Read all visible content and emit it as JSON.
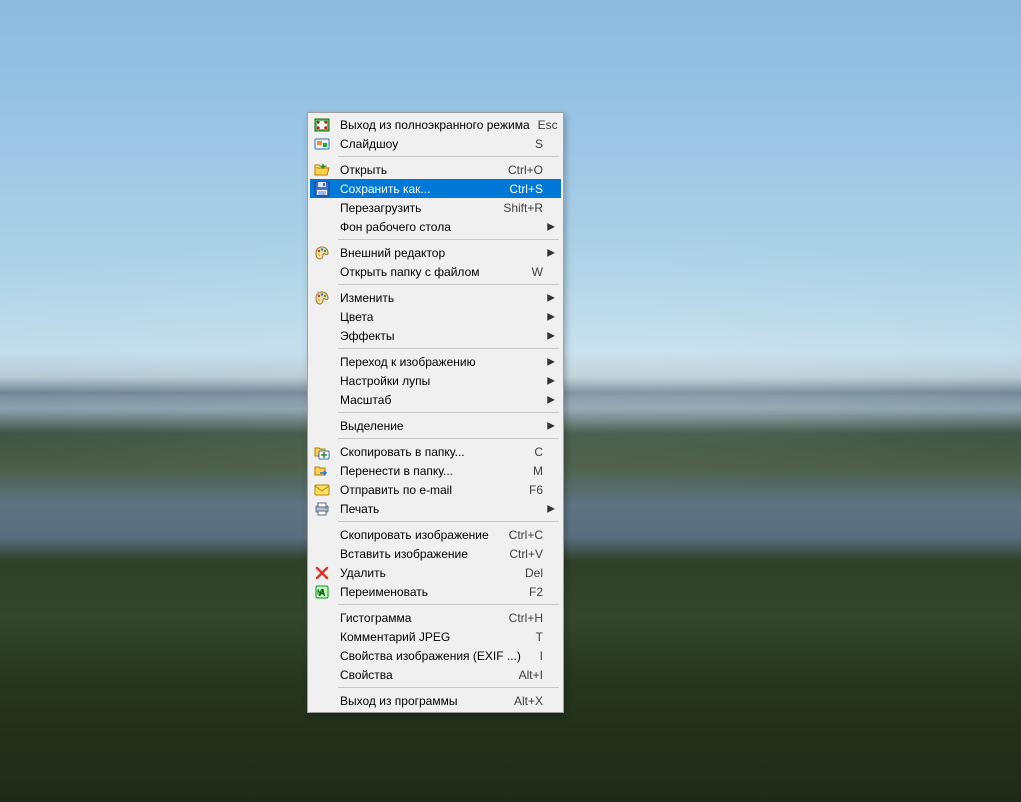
{
  "menu": {
    "groups": [
      [
        {
          "icon": "exit-fullscreen-icon",
          "label": "Выход из полноэкранного режима",
          "shortcut": "Esc",
          "submenu": false,
          "highlighted": false,
          "name": "menu-exit-fullscreen"
        },
        {
          "icon": "slideshow-icon",
          "label": "Слайдшоу",
          "shortcut": "S",
          "submenu": false,
          "highlighted": false,
          "name": "menu-slideshow"
        }
      ],
      [
        {
          "icon": "open-icon",
          "label": "Открыть",
          "shortcut": "Ctrl+O",
          "submenu": false,
          "highlighted": false,
          "name": "menu-open"
        },
        {
          "icon": "save-icon",
          "label": "Сохранить как...",
          "shortcut": "Ctrl+S",
          "submenu": false,
          "highlighted": true,
          "name": "menu-save-as"
        },
        {
          "icon": null,
          "label": "Перезагрузить",
          "shortcut": "Shift+R",
          "submenu": false,
          "highlighted": false,
          "name": "menu-reload"
        },
        {
          "icon": null,
          "label": "Фон рабочего стола",
          "shortcut": "",
          "submenu": true,
          "highlighted": false,
          "name": "menu-desktop-background"
        }
      ],
      [
        {
          "icon": "palette-icon",
          "label": "Внешний редактор",
          "shortcut": "",
          "submenu": true,
          "highlighted": false,
          "name": "menu-external-editor"
        },
        {
          "icon": null,
          "label": "Открыть папку с файлом",
          "shortcut": "W",
          "submenu": false,
          "highlighted": false,
          "name": "menu-open-folder"
        }
      ],
      [
        {
          "icon": "palette-icon",
          "label": "Изменить",
          "shortcut": "",
          "submenu": true,
          "highlighted": false,
          "name": "menu-edit"
        },
        {
          "icon": null,
          "label": "Цвета",
          "shortcut": "",
          "submenu": true,
          "highlighted": false,
          "name": "menu-colors"
        },
        {
          "icon": null,
          "label": "Эффекты",
          "shortcut": "",
          "submenu": true,
          "highlighted": false,
          "name": "menu-effects"
        }
      ],
      [
        {
          "icon": null,
          "label": "Переход к изображению",
          "shortcut": "",
          "submenu": true,
          "highlighted": false,
          "name": "menu-navigate-image"
        },
        {
          "icon": null,
          "label": "Настройки лупы",
          "shortcut": "",
          "submenu": true,
          "highlighted": false,
          "name": "menu-magnifier-settings"
        },
        {
          "icon": null,
          "label": "Масштаб",
          "shortcut": "",
          "submenu": true,
          "highlighted": false,
          "name": "menu-zoom"
        }
      ],
      [
        {
          "icon": null,
          "label": "Выделение",
          "shortcut": "",
          "submenu": true,
          "highlighted": false,
          "name": "menu-selection"
        }
      ],
      [
        {
          "icon": "copy-folder-icon",
          "label": "Скопировать в папку...",
          "shortcut": "C",
          "submenu": false,
          "highlighted": false,
          "name": "menu-copy-to-folder"
        },
        {
          "icon": "move-folder-icon",
          "label": "Перенести в папку...",
          "shortcut": "M",
          "submenu": false,
          "highlighted": false,
          "name": "menu-move-to-folder"
        },
        {
          "icon": "mail-icon",
          "label": "Отправить по e-mail",
          "shortcut": "F6",
          "submenu": false,
          "highlighted": false,
          "name": "menu-send-email"
        },
        {
          "icon": "print-icon",
          "label": "Печать",
          "shortcut": "",
          "submenu": true,
          "highlighted": false,
          "name": "menu-print"
        }
      ],
      [
        {
          "icon": null,
          "label": "Скопировать изображение",
          "shortcut": "Ctrl+C",
          "submenu": false,
          "highlighted": false,
          "name": "menu-copy-image"
        },
        {
          "icon": null,
          "label": "Вставить изображение",
          "shortcut": "Ctrl+V",
          "submenu": false,
          "highlighted": false,
          "name": "menu-paste-image"
        },
        {
          "icon": "delete-icon",
          "label": "Удалить",
          "shortcut": "Del",
          "submenu": false,
          "highlighted": false,
          "name": "menu-delete"
        },
        {
          "icon": "rename-icon",
          "label": "Переименовать",
          "shortcut": "F2",
          "submenu": false,
          "highlighted": false,
          "name": "menu-rename"
        }
      ],
      [
        {
          "icon": null,
          "label": "Гистограмма",
          "shortcut": "Ctrl+H",
          "submenu": false,
          "highlighted": false,
          "name": "menu-histogram"
        },
        {
          "icon": null,
          "label": "Комментарий JPEG",
          "shortcut": "T",
          "submenu": false,
          "highlighted": false,
          "name": "menu-jpeg-comment"
        },
        {
          "icon": null,
          "label": "Свойства изображения (EXIF ...)",
          "shortcut": "I",
          "submenu": false,
          "highlighted": false,
          "name": "menu-image-properties"
        },
        {
          "icon": null,
          "label": "Свойства",
          "shortcut": "Alt+I",
          "submenu": false,
          "highlighted": false,
          "name": "menu-properties"
        }
      ],
      [
        {
          "icon": null,
          "label": "Выход из программы",
          "shortcut": "Alt+X",
          "submenu": false,
          "highlighted": false,
          "name": "menu-exit-program"
        }
      ]
    ]
  }
}
